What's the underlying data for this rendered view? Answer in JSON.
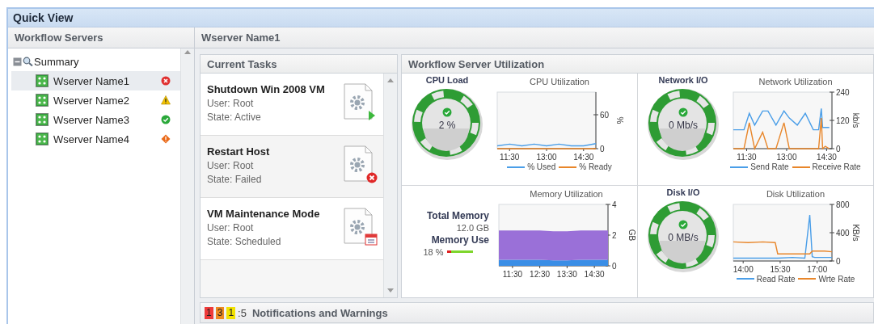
{
  "window": {
    "title": "Quick View"
  },
  "sidebar": {
    "title": "Workflow Servers",
    "tree": [
      {
        "label": "Summary",
        "expanded": true,
        "children": [
          {
            "label": "Wserver Name1",
            "kind": "error",
            "selected": true
          },
          {
            "label": "Wserver Name2",
            "kind": "warning",
            "selected": false
          },
          {
            "label": "Wserver Name3",
            "kind": "ok",
            "selected": false
          },
          {
            "label": "Wserver Name4",
            "kind": "critical",
            "selected": false
          }
        ]
      }
    ]
  },
  "content": {
    "title": "Wserver Name1",
    "current_tasks": {
      "title": "Current Tasks",
      "tasks": [
        {
          "name": "Shutdown Win 2008 VM",
          "user": "User: Root",
          "state": "State: Active",
          "kind": "active"
        },
        {
          "name": "Restart Host",
          "user": "User: Root",
          "state": "State: Failed",
          "kind": "failed"
        },
        {
          "name": "VM Maintenance Mode",
          "user": "User: Root",
          "state": "State: Scheduled",
          "kind": "scheduled"
        }
      ]
    },
    "utilization": {
      "title": "Workflow Server Utilization",
      "cells": [
        {
          "kind": "gauge",
          "title": "CPU Load",
          "reading": "2 %",
          "healthy": true,
          "chart_data": {
            "type": "line",
            "title": "CPU Utilization",
            "legend": "bottom",
            "ylabel": "%",
            "x": [
              11.0,
              11.5,
              12.0,
              12.5,
              13.0,
              13.5,
              14.0,
              14.5,
              15.0
            ],
            "xlim": [
              11.0,
              15.0
            ],
            "ylim": [
              0,
              100
            ],
            "xticks": [
              {
                "value": 11.5,
                "label": "11:30"
              },
              {
                "value": 13.0,
                "label": "13:00"
              },
              {
                "value": 14.5,
                "label": "14:30"
              }
            ],
            "yticks": [
              0,
              60
            ],
            "series": [
              {
                "name": "% Used",
                "color": "#4a9ee8",
                "values": [
                  5,
                  8,
                  5,
                  8,
                  5,
                  8,
                  5,
                  5,
                  9
                ]
              },
              {
                "name": "% Ready",
                "color": "#e8862a",
                "values": [
                  0,
                  0,
                  0,
                  0,
                  0,
                  0,
                  0,
                  0,
                  0
                ]
              }
            ]
          }
        },
        {
          "kind": "gauge",
          "title": "Network I/O",
          "reading": "0 Mb/s",
          "healthy": true,
          "chart_data": {
            "type": "line",
            "title": "Network Utilization",
            "legend": "bottom",
            "ylabel": "kb/s",
            "x": [
              11.0,
              11.4,
              11.6,
              11.8,
              12.1,
              12.3,
              12.6,
              12.9,
              13.1,
              13.4,
              13.7,
              14.0,
              14.2,
              14.3,
              14.35,
              14.45,
              14.6
            ],
            "xlim": [
              11.0,
              14.7
            ],
            "ylim": [
              0,
              240
            ],
            "xticks": [
              {
                "value": 11.5,
                "label": "11:30"
              },
              {
                "value": 13.0,
                "label": "13:00"
              },
              {
                "value": 14.5,
                "label": "14:30"
              }
            ],
            "yticks": [
              0,
              120,
              240
            ],
            "series": [
              {
                "name": "Send Rate",
                "color": "#4a9ee8",
                "values": [
                  80,
                  80,
                  150,
                  100,
                  160,
                  160,
                  100,
                  160,
                  130,
                  100,
                  150,
                  80,
                  80,
                  170,
                  90,
                  90,
                  90
                ]
              },
              {
                "name": "Receive Rate",
                "color": "#e8862a",
                "values": [
                  0,
                  0,
                  110,
                  0,
                  70,
                  0,
                  0,
                  110,
                  0,
                  0,
                  0,
                  0,
                  0,
                  130,
                  0,
                  10,
                  0
                ]
              }
            ]
          }
        },
        {
          "kind": "memory",
          "total_label": "Total Memory",
          "total": "12.0 GB",
          "use_label": "Memory Use",
          "use": "18 %",
          "level": 0.18,
          "chart_data": {
            "type": "area",
            "title": "Memory Utilization",
            "ylabel": "GB",
            "stacked": true,
            "x": [
              11.0,
              11.5,
              12.0,
              12.5,
              13.0,
              13.5,
              14.0,
              14.5,
              15.0
            ],
            "xlim": [
              11.0,
              15.0
            ],
            "ylim": [
              0,
              4
            ],
            "xticks": [
              {
                "value": 11.5,
                "label": "11:30"
              },
              {
                "value": 12.5,
                "label": "12:30"
              },
              {
                "value": 13.5,
                "label": "13:30"
              },
              {
                "value": 14.5,
                "label": "14:30"
              }
            ],
            "yticks": [
              0,
              2,
              4
            ],
            "series": [
              {
                "color": "#3a8ee6",
                "values": [
                  0.4,
                  0.4,
                  0.4,
                  0.4,
                  0.35,
                  0.35,
                  0.4,
                  0.4,
                  0.4
                ]
              },
              {
                "color": "#9a70d8",
                "values": [
                  1.9,
                  1.9,
                  1.9,
                  1.9,
                  1.9,
                  1.9,
                  1.9,
                  1.9,
                  1.9
                ]
              }
            ]
          }
        },
        {
          "kind": "gauge",
          "title": "Disk I/O",
          "reading": "0 MB/s",
          "healthy": true,
          "chart_data": {
            "type": "line",
            "title": "Disk Utilization",
            "legend": "bottom",
            "ylabel": "KB/s",
            "x": [
              13.6,
              14.2,
              14.8,
              15.3,
              15.4,
              16.0,
              16.5,
              16.7,
              16.8,
              16.9,
              17.3,
              17.6
            ],
            "xlim": [
              13.6,
              17.6
            ],
            "ylim": [
              0,
              800
            ],
            "xticks": [
              {
                "value": 14.0,
                "label": "14:00"
              },
              {
                "value": 15.5,
                "label": "15:30"
              },
              {
                "value": 17.0,
                "label": "17:00"
              }
            ],
            "yticks": [
              0,
              400,
              800
            ],
            "series": [
              {
                "name": "Read Rate",
                "color": "#4a9ee8",
                "values": [
                  40,
                  40,
                  40,
                  40,
                  40,
                  50,
                  40,
                  650,
                  60,
                  50,
                  50,
                  50
                ]
              },
              {
                "name": "Wrte Rate",
                "color": "#e8862a",
                "values": [
                  270,
                  260,
                  270,
                  260,
                  100,
                  100,
                  100,
                  100,
                  140,
                  140,
                  140,
                  130
                ]
              }
            ]
          }
        }
      ]
    },
    "notifications": {
      "counts": [
        {
          "count": "1",
          "color": "#ee3a3a"
        },
        {
          "count": "3",
          "color": "#ee8a20"
        },
        {
          "count": "1",
          "color": "#f2e200"
        }
      ],
      "total": ":5",
      "title": "Notifications and Warnings"
    }
  }
}
